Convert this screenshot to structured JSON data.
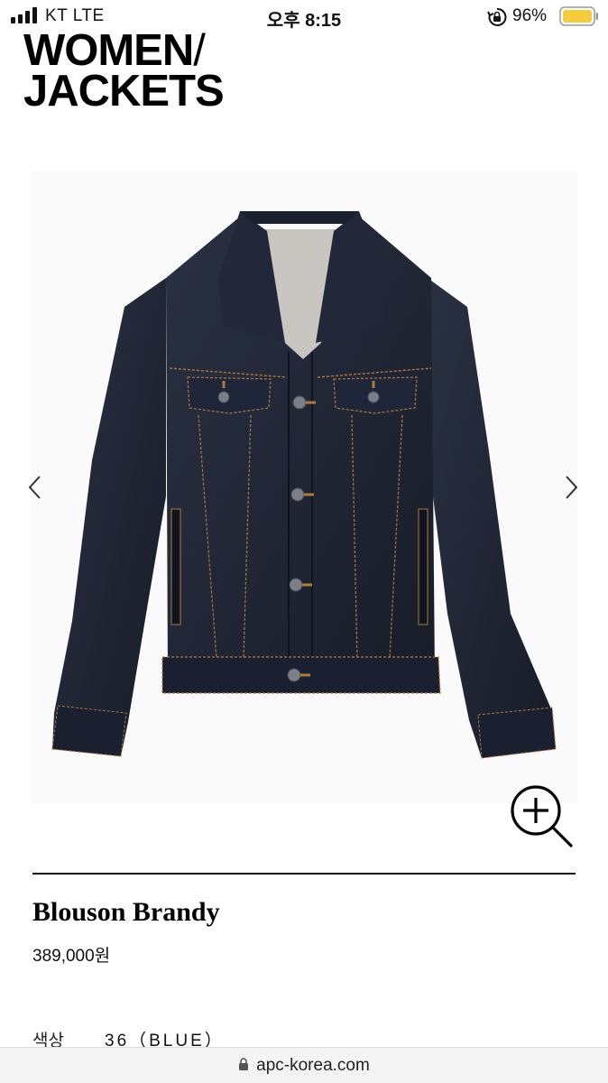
{
  "status_bar": {
    "carrier": "KT  LTE",
    "time": "오후 8:15",
    "battery": "96%"
  },
  "header": {
    "line1": "WOMEN",
    "slash": "/",
    "line2": "JACKETS"
  },
  "product": {
    "name": "Blouson Brandy",
    "price": "389,000원",
    "option_label": "색상",
    "option_value": "36（BLUE）"
  },
  "browser": {
    "url": "apc-korea.com"
  },
  "icons": {
    "signal": "signal-icon",
    "rotation_lock": "rotation-lock-icon",
    "battery": "battery-icon",
    "prev": "chevron-left-icon",
    "next": "chevron-right-icon",
    "zoom": "zoom-in-icon",
    "lock": "padlock-icon"
  },
  "colors": {
    "denim": "#1e2433",
    "stitching": "#b07a3c",
    "battery": "#f5cd3c"
  }
}
